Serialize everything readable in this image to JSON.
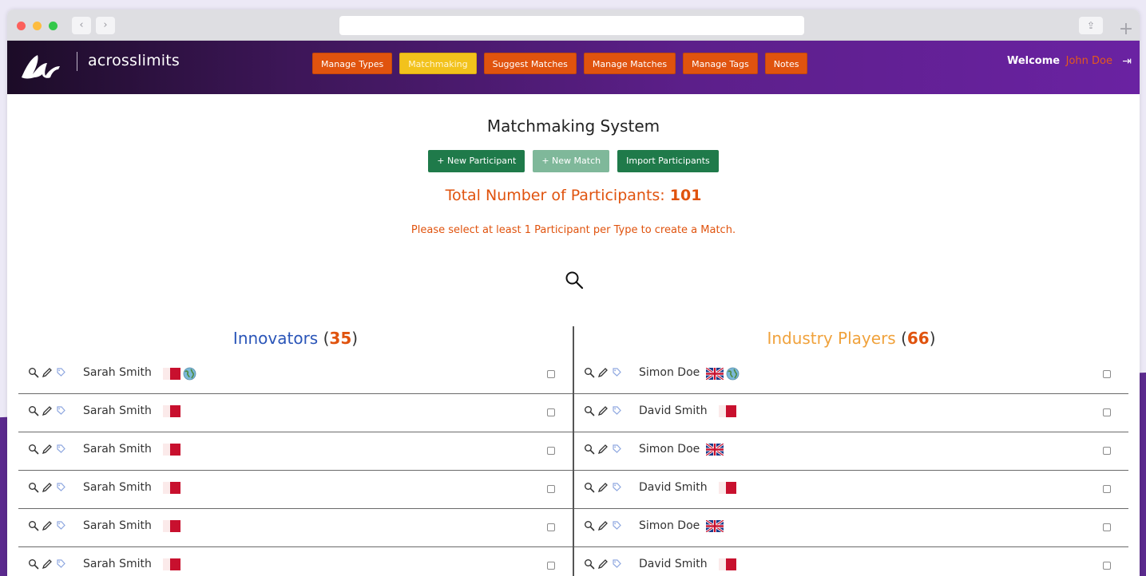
{
  "brand": {
    "logo_text": "acrosslimits"
  },
  "nav": [
    {
      "label": "Manage Types",
      "active": false
    },
    {
      "label": "Matchmaking",
      "active": true
    },
    {
      "label": "Suggest Matches",
      "active": false
    },
    {
      "label": "Manage Matches",
      "active": false
    },
    {
      "label": "Manage Tags",
      "active": false
    },
    {
      "label": "Notes",
      "active": false
    }
  ],
  "welcome": {
    "greeting": "Welcome",
    "user": "John Doe"
  },
  "page": {
    "title": "Matchmaking System",
    "buttons": {
      "new_participant": "+ New Participant",
      "new_match": "+ New Match",
      "import": "Import Participants"
    },
    "total_label": "Total Number of Participants:",
    "total_value": "101",
    "hint": "Please select at least 1 Participant per Type to create a Match."
  },
  "columns": {
    "left": {
      "title": "Innovators",
      "count": "35",
      "rows": [
        {
          "name": "Sarah Smith",
          "flags": [
            "malta"
          ],
          "globe": true
        },
        {
          "name": "Sarah Smith",
          "flags": [
            "malta"
          ],
          "globe": false
        },
        {
          "name": "Sarah Smith",
          "flags": [
            "malta"
          ],
          "globe": false
        },
        {
          "name": "Sarah Smith",
          "flags": [
            "malta"
          ],
          "globe": false
        },
        {
          "name": "Sarah Smith",
          "flags": [
            "malta"
          ],
          "globe": false
        },
        {
          "name": "Sarah Smith",
          "flags": [
            "malta"
          ],
          "globe": false
        }
      ]
    },
    "right": {
      "title": "Industry Players",
      "count": "66",
      "rows": [
        {
          "name": "Simon Doe",
          "flags": [
            "uk"
          ],
          "globe": true
        },
        {
          "name": "David Smith",
          "flags": [
            "malta"
          ],
          "globe": false
        },
        {
          "name": "Simon Doe",
          "flags": [
            "uk"
          ],
          "globe": false
        },
        {
          "name": "David Smith",
          "flags": [
            "malta"
          ],
          "globe": false
        },
        {
          "name": "Simon Doe",
          "flags": [
            "uk"
          ],
          "globe": false
        },
        {
          "name": "David Smith",
          "flags": [
            "malta"
          ],
          "globe": false
        }
      ]
    }
  },
  "colors": {
    "nav_orange": "#e0530e",
    "nav_active_yellow": "#f2c21c",
    "button_green": "#1f7a4a",
    "innovators_blue": "#2a55b8",
    "industry_orange": "#f0a23c"
  }
}
